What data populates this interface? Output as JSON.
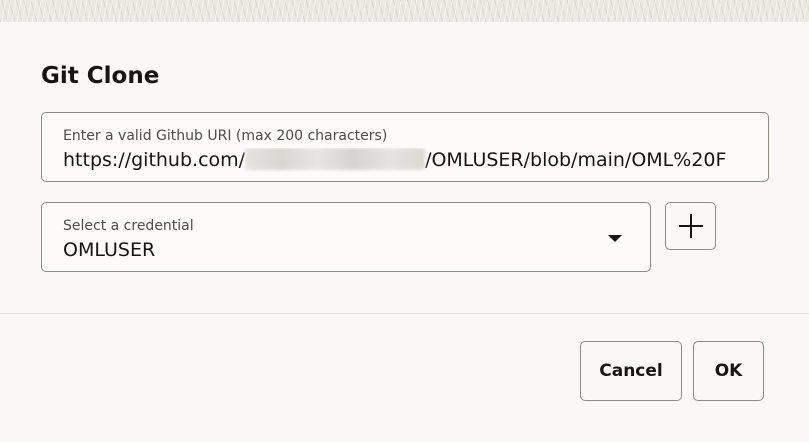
{
  "dialog": {
    "title": "Git Clone"
  },
  "uri_field": {
    "label": "Enter a valid Github URI (max 200 characters)",
    "value_prefix": "https://github.com/",
    "value_suffix": "/OMLUSER/blob/main/OML%20F"
  },
  "credential_field": {
    "label": "Select a credential",
    "selected_value": "OMLUSER",
    "dropdown_icon": "caret-down"
  },
  "add_credential": {
    "icon": "plus"
  },
  "footer": {
    "cancel_label": "Cancel",
    "ok_label": "OK"
  },
  "colors": {
    "background": "#f9f8f6",
    "border": "#8f8b84",
    "text": "#161513"
  }
}
